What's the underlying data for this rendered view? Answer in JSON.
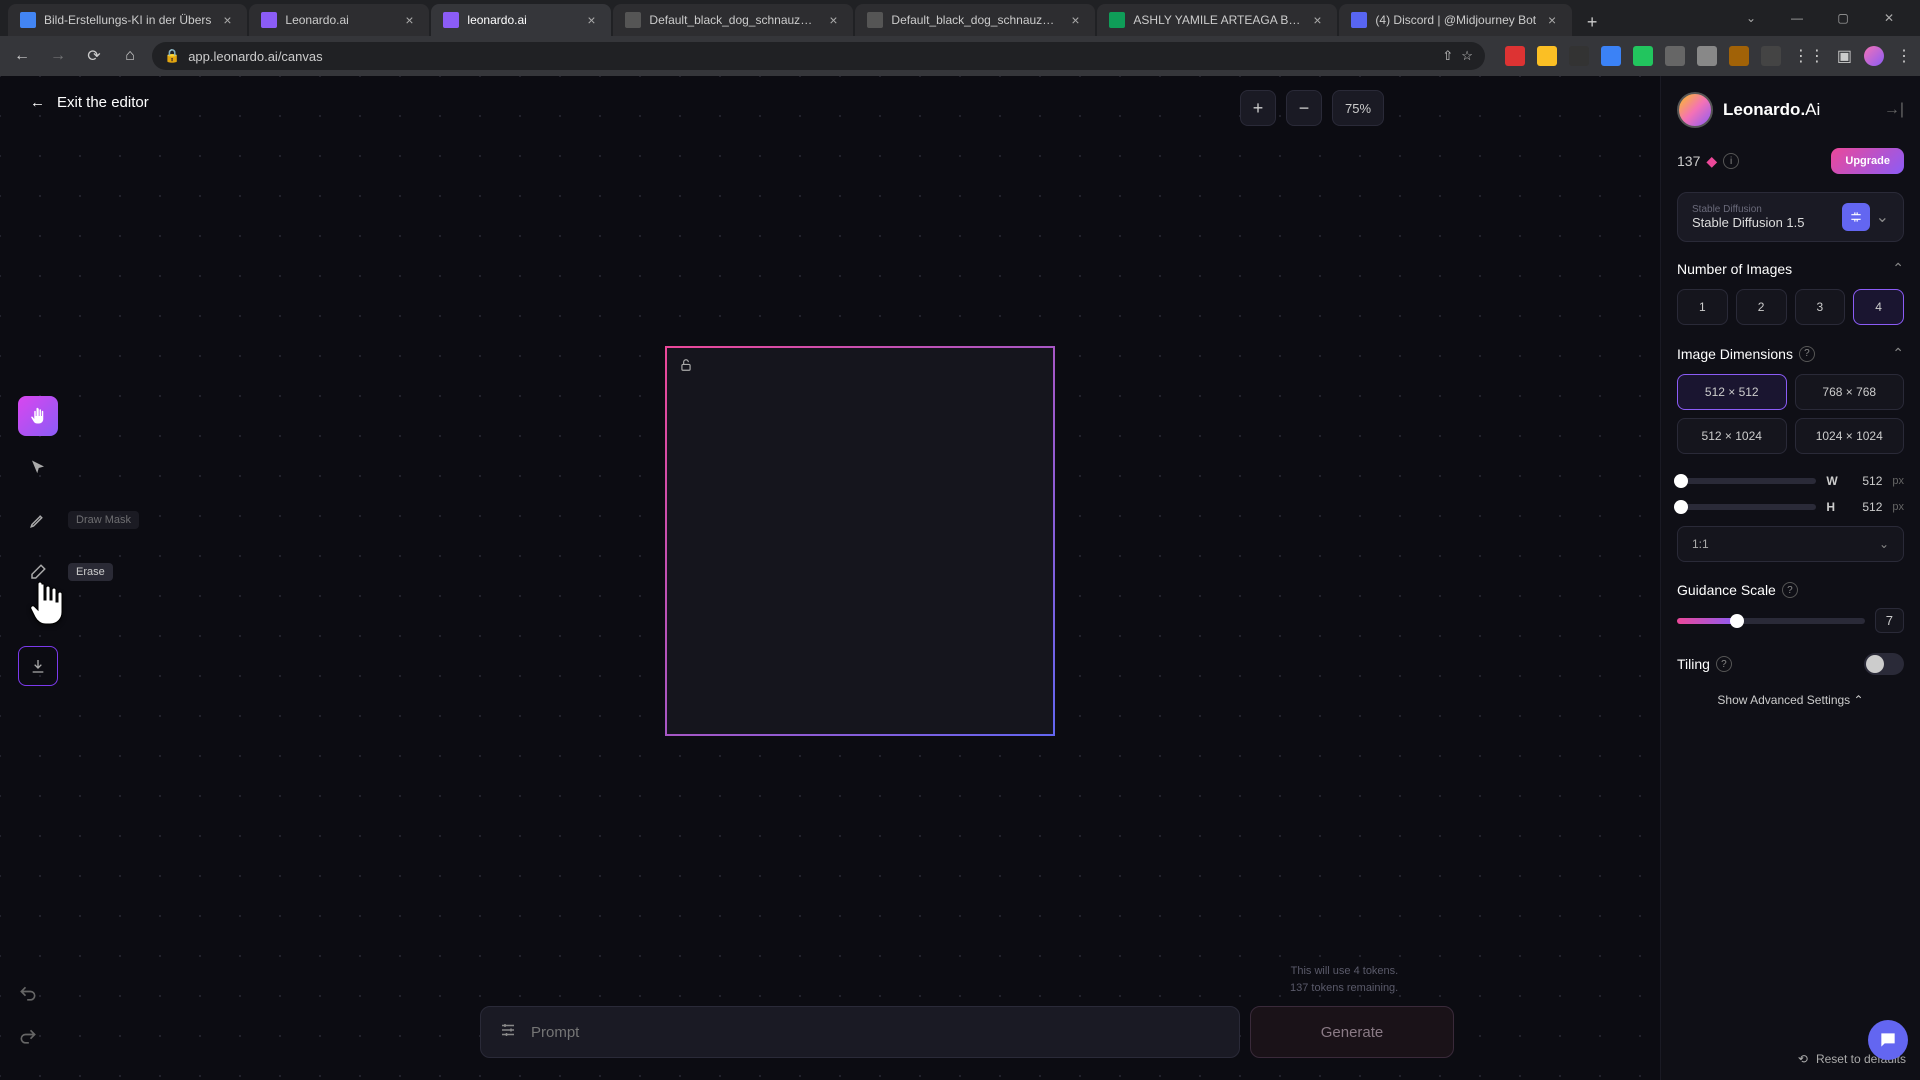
{
  "browser": {
    "tabs": [
      {
        "title": "Bild-Erstellungs-KI in der Übers",
        "favicon": "#4285f4"
      },
      {
        "title": "Leonardo.ai",
        "favicon": "#8b5cf6"
      },
      {
        "title": "leonardo.ai",
        "favicon": "#8b5cf6",
        "active": true
      },
      {
        "title": "Default_black_dog_schnauzer_f",
        "favicon": "#555"
      },
      {
        "title": "Default_black_dog_schnauzer_f",
        "favicon": "#555"
      },
      {
        "title": "ASHLY YAMILE ARTEAGA BLAN",
        "favicon": "#0f9d58"
      },
      {
        "title": "(4) Discord | @Midjourney Bot",
        "favicon": "#5865f2"
      }
    ],
    "url": "app.leonardo.ai/canvas"
  },
  "editor": {
    "exit_label": "Exit the editor",
    "zoom": "75%",
    "tooltip_erase": "Erase",
    "tooltip_draw": "Draw Mask"
  },
  "prompt": {
    "placeholder": "Prompt",
    "generate": "Generate",
    "token_line1": "This will use 4 tokens.",
    "token_line2": "137 tokens remaining."
  },
  "panel": {
    "logo_main": "Leonardo.",
    "logo_ai": "Ai",
    "tokens": "137",
    "upgrade": "Upgrade",
    "model_sub": "Stable Diffusion",
    "model_main": "Stable Diffusion 1.5",
    "num_images_title": "Number of Images",
    "num_options": [
      "1",
      "2",
      "3",
      "4"
    ],
    "num_selected": "4",
    "dim_title": "Image Dimensions",
    "dim_options": [
      "512 × 512",
      "768 × 768",
      "512 × 1024",
      "1024 × 1024"
    ],
    "dim_selected": "512 × 512",
    "width_label": "W",
    "width_val": "512",
    "height_label": "H",
    "height_val": "512",
    "px": "px",
    "aspect": "1:1",
    "guidance_title": "Guidance Scale",
    "guidance_val": "7",
    "tiling_title": "Tiling",
    "adv_label": "Show Advanced Settings",
    "reset_label": "Reset to defaults"
  }
}
